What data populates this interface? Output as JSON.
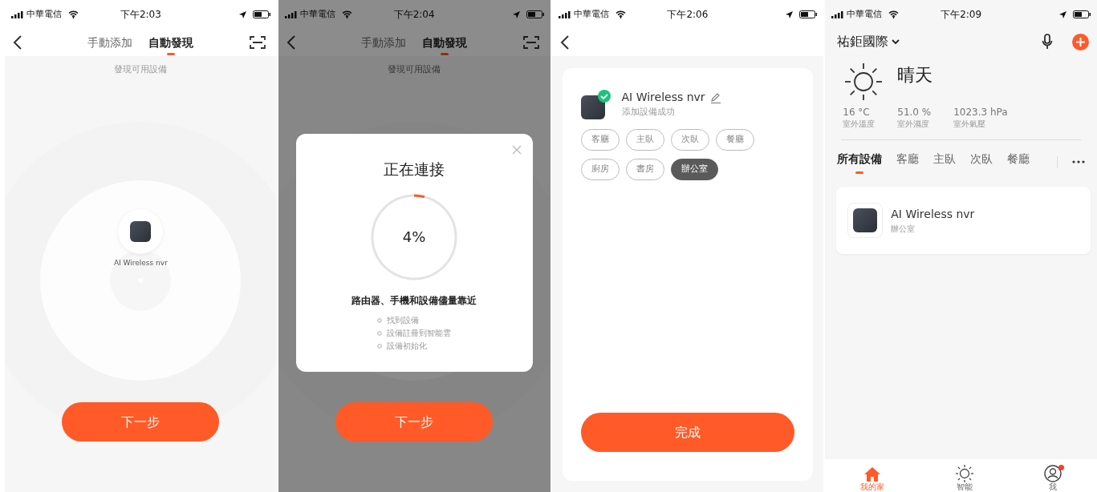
{
  "screens": [
    {
      "kind": "discover",
      "status_bar": {
        "carrier": "中華電信",
        "time": "下午2:03"
      },
      "tabs": [
        {
          "label": "手動添加",
          "selected": false
        },
        {
          "label": "自動發現",
          "selected": true
        }
      ],
      "subtitle": "發現可用設備",
      "device": {
        "name": "AI Wireless nvr"
      },
      "button": "下一步"
    },
    {
      "kind": "connecting",
      "status_bar": {
        "carrier": "中華電信",
        "time": "下午2:04"
      },
      "tabs": [
        {
          "label": "手動添加",
          "selected": false
        },
        {
          "label": "自動發現",
          "selected": true
        }
      ],
      "subtitle": "發現可用設備",
      "button": "下一步",
      "dialog": {
        "title": "正在連接",
        "level": 0.04,
        "percent": "4%",
        "hint": "路由器、手機和設備儘量靠近",
        "steps": [
          "找到設備",
          "設備註冊到智能雲",
          "設備初始化"
        ]
      }
    },
    {
      "kind": "success",
      "status_bar": {
        "carrier": "中華電信",
        "time": "下午2:06"
      },
      "device": {
        "name": "AI Wireless nvr",
        "status": "添加設備成功"
      },
      "rooms": [
        {
          "label": "客廳",
          "selected": false
        },
        {
          "label": "主臥",
          "selected": false
        },
        {
          "label": "次臥",
          "selected": false
        },
        {
          "label": "餐廳",
          "selected": false
        },
        {
          "label": "廚房",
          "selected": false
        },
        {
          "label": "書房",
          "selected": false
        },
        {
          "label": "辦公室",
          "selected": true
        }
      ],
      "button": "完成"
    },
    {
      "kind": "home",
      "status_bar": {
        "carrier": "中華電信",
        "time": "下午2:09"
      },
      "home_name": "祐鉅國際",
      "weather": {
        "condition": "晴天",
        "stats": [
          {
            "value": "16 °C",
            "label": "室外溫度"
          },
          {
            "value": "51.0 %",
            "label": "室外濕度"
          },
          {
            "value": "1023.3 hPa",
            "label": "室外氣壓"
          }
        ]
      },
      "room_tabs": [
        {
          "label": "所有設備",
          "selected": true
        },
        {
          "label": "客廳",
          "selected": false
        },
        {
          "label": "主臥",
          "selected": false
        },
        {
          "label": "次臥",
          "selected": false
        },
        {
          "label": "餐廳",
          "selected": false
        }
      ],
      "devices": [
        {
          "name": "AI Wireless nvr",
          "room": "辦公室"
        }
      ],
      "nav": [
        {
          "label": "我的家",
          "selected": true,
          "badge": false
        },
        {
          "label": "智能",
          "selected": false,
          "badge": false
        },
        {
          "label": "我",
          "selected": false,
          "badge": true
        }
      ]
    }
  ]
}
